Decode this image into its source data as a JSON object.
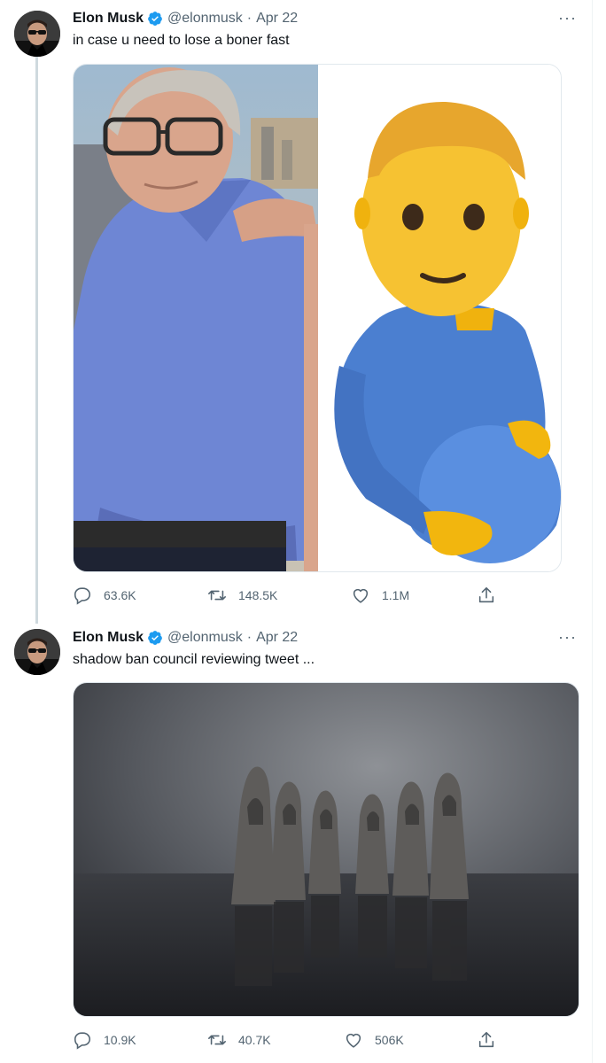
{
  "tweets": [
    {
      "author": {
        "name": "Elon Musk",
        "handle": "@elonmusk"
      },
      "separator": "·",
      "date": "Apr 22",
      "text": "in case u need to lose a boner fast",
      "more_label": "···",
      "media": {
        "type": "image-collage",
        "panels": [
          "photo-man-blue-polo",
          "pregnant-man-emoji"
        ]
      },
      "stats": {
        "replies": "63.6K",
        "retweets": "148.5K",
        "likes": "1.1M"
      },
      "icons": [
        "reply-icon",
        "retweet-icon",
        "like-icon",
        "share-icon"
      ]
    },
    {
      "author": {
        "name": "Elon Musk",
        "handle": "@elonmusk"
      },
      "separator": "·",
      "date": "Apr 22",
      "text": "shadow ban council reviewing tweet ...",
      "more_label": "···",
      "media": {
        "type": "image",
        "panels": [
          "hooded-figures-photo"
        ]
      },
      "stats": {
        "replies": "10.9K",
        "retweets": "40.7K",
        "likes": "506K"
      },
      "icons": [
        "reply-icon",
        "retweet-icon",
        "like-icon",
        "share-icon"
      ]
    }
  ],
  "colors": {
    "verified": "#1d9bf0",
    "text": "#0f1419",
    "secondary": "#536471",
    "thread_line": "#cfd9de"
  }
}
